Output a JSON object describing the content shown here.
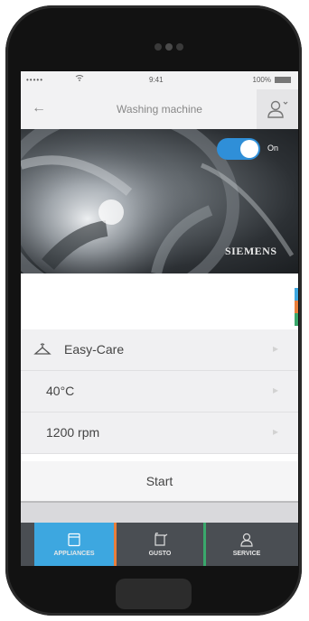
{
  "status_bar": {
    "carrier": "•••••",
    "time": "9:41",
    "battery": "100%"
  },
  "navbar": {
    "back_icon": "arrow-left-icon",
    "title": "Washing machine",
    "user_icon": "user-icon"
  },
  "hero": {
    "toggle_label": "On",
    "toggle_state": true,
    "brand": "SIEMENS"
  },
  "settings": [
    {
      "label": "Easy-Care",
      "icon": "shirt-icon"
    },
    {
      "label": "40°C"
    },
    {
      "label": "1200 rpm"
    }
  ],
  "actions": {
    "start_label": "Start"
  },
  "tabbar": {
    "tabs": [
      {
        "label": "APPLIANCES",
        "icon": "appliances-icon",
        "active": true,
        "accent": "#e87e3a"
      },
      {
        "label": "GUSTO",
        "icon": "gusto-icon",
        "active": false,
        "accent": "#3aa86b"
      },
      {
        "label": "SERVICE",
        "icon": "service-icon",
        "active": false
      }
    ]
  },
  "colors": {
    "active_tab": "#3da7e0",
    "toggle": "#2f8fd8",
    "tabbar": "#4a4e53"
  }
}
